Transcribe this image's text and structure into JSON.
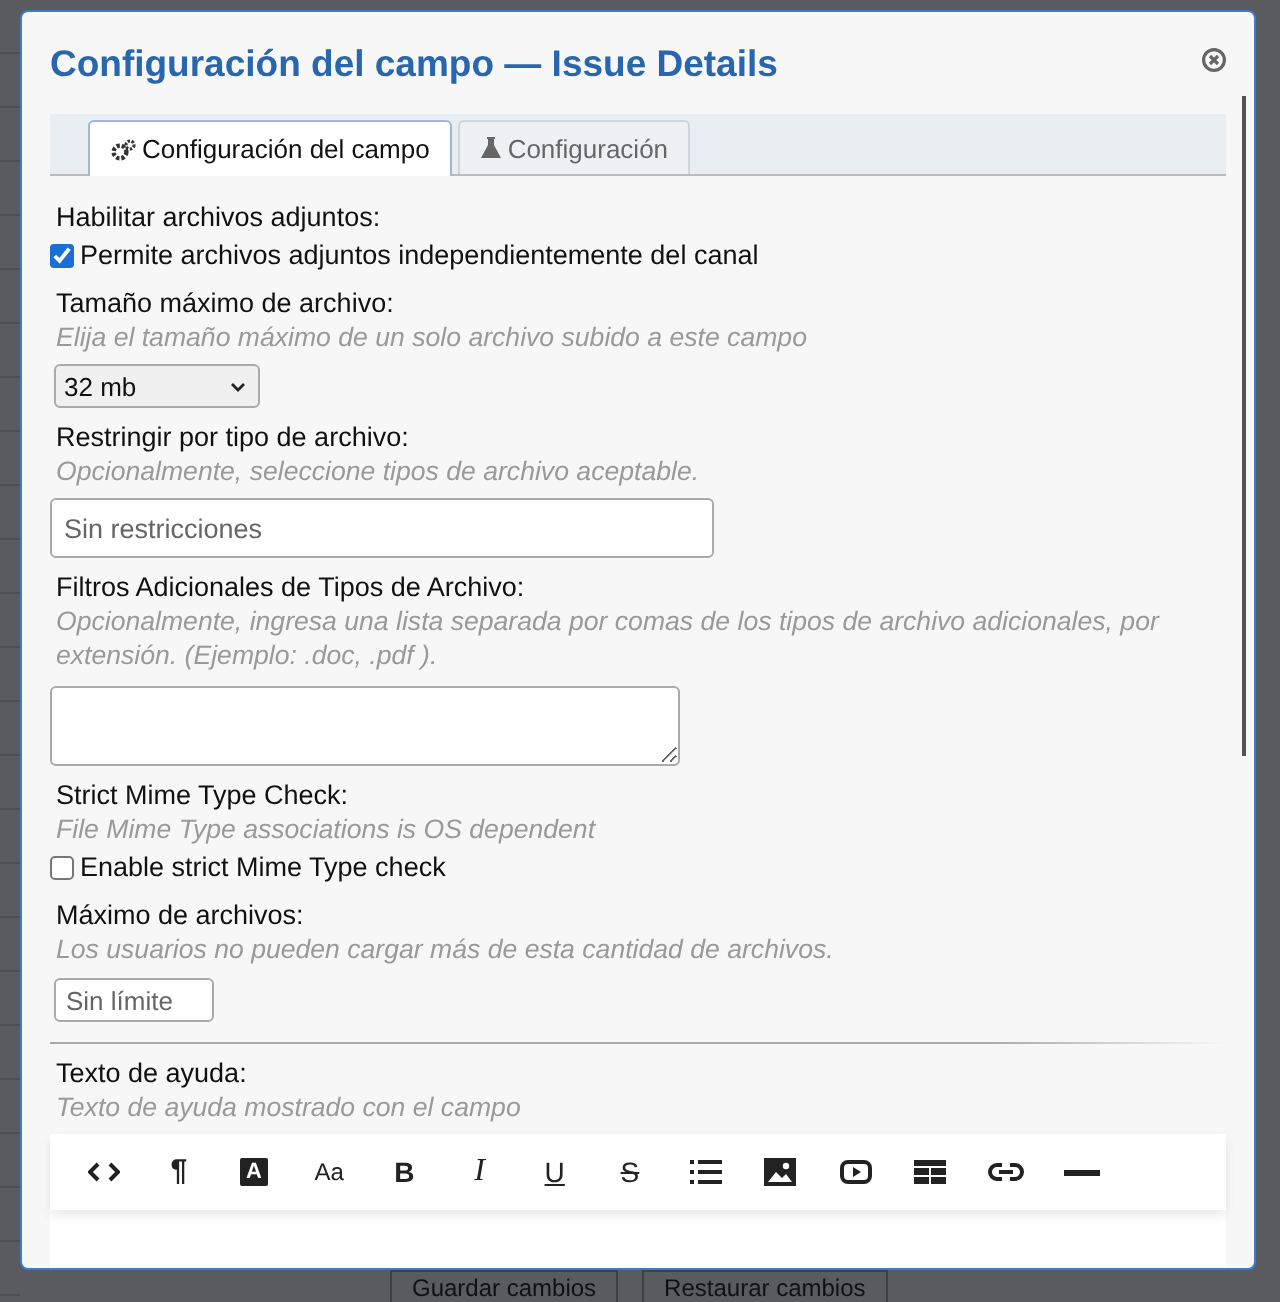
{
  "background": {
    "buttons": [
      "Guardar cambios",
      "Restaurar cambios"
    ]
  },
  "dialog": {
    "title": "Configuración del campo — Issue Details"
  },
  "tabs": [
    {
      "label": "Configuración del campo",
      "selected": true
    },
    {
      "label": "Configuración",
      "selected": false
    }
  ],
  "fields": [
    {
      "kind": "checkbox",
      "label": "Habilitar archivos adjuntos:",
      "option": "Permite archivos adjuntos independientemente del canal",
      "checked": true
    },
    {
      "kind": "select",
      "label": "Tamaño máximo de archivo:",
      "hint": "Elija el tamaño máximo de un solo archivo subido a este campo",
      "value": "32 mb"
    },
    {
      "kind": "text",
      "label": "Restringir por tipo de archivo:",
      "hint": "Opcionalmente, seleccione tipos de archivo aceptable.",
      "placeholder": "Sin restricciones"
    },
    {
      "kind": "textarea",
      "label": "Filtros Adicionales de Tipos de Archivo:",
      "hint": "Opcionalmente, ingresa una lista separada por comas de los tipos de archivo adicionales, por extensión. (Ejemplo: .doc, .pdf )."
    },
    {
      "kind": "checkbox",
      "label": "Strict Mime Type Check:",
      "hint": "File Mime Type associations is OS dependent",
      "option": "Enable strict Mime Type check",
      "checked": false
    },
    {
      "kind": "number",
      "label": "Máximo de archivos:",
      "hint": "Los usuarios no pueden cargar más de esta cantidad de archivos.",
      "placeholder": "Sin límite"
    },
    {
      "kind": "editor",
      "label": "Texto de ayuda:",
      "hint": "Texto de ayuda mostrado con el campo"
    }
  ],
  "editor_tools": [
    {
      "kind": "code"
    },
    {
      "kind": "paragraph",
      "label": "¶"
    },
    {
      "kind": "color",
      "label": "A"
    },
    {
      "kind": "font-size",
      "label": "Aa"
    },
    {
      "kind": "bold",
      "label": "B"
    },
    {
      "kind": "italic",
      "label": "I"
    },
    {
      "kind": "underline",
      "label": "U"
    },
    {
      "kind": "strike",
      "label": "S"
    },
    {
      "kind": "list"
    },
    {
      "kind": "image"
    },
    {
      "kind": "video"
    },
    {
      "kind": "table"
    },
    {
      "kind": "link"
    },
    {
      "kind": "rule"
    }
  ]
}
